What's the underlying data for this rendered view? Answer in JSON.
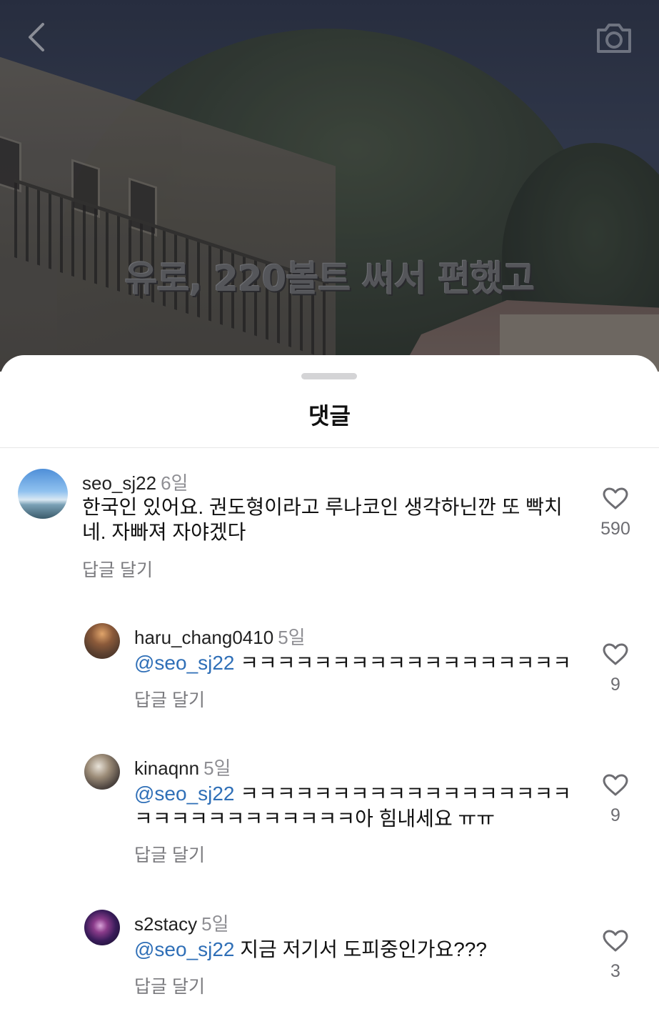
{
  "video": {
    "caption": "유로, 220볼트 써서 편했고"
  },
  "sheet": {
    "title": "댓글"
  },
  "comments": [
    {
      "username": "seo_sj22",
      "time": "6일",
      "text": "한국인 있어요. 권도형이라고 루나코인 생각하닌깐 또 빡치네. 자빠져 자야겠다",
      "reply_label": "답글 달기",
      "likes": "590"
    },
    {
      "username": "haru_chang0410",
      "time": "5일",
      "mention": "@seo_sj22",
      "text": "ㅋㅋㅋㅋㅋㅋㅋㅋㅋㅋㅋㅋㅋㅋㅋㅋㅋㅋ",
      "reply_label": "답글 달기",
      "likes": "9"
    },
    {
      "username": "kinaqnn",
      "time": "5일",
      "mention": "@seo_sj22",
      "text": "ㅋㅋㅋㅋㅋㅋㅋㅋㅋㅋㅋㅋㅋㅋㅋㅋㅋㅋㅋㅋㅋㅋㅋㅋㅋㅋㅋㅋㅋㅋ아 힘내세요 ㅠㅠ",
      "reply_label": "답글 달기",
      "likes": "9"
    },
    {
      "username": "s2stacy",
      "time": "5일",
      "mention": "@seo_sj22",
      "text": "지금 저기서 도피중인가요???",
      "reply_label": "답글 달기",
      "likes": "3"
    }
  ],
  "icons": {
    "back": "chevron-left-icon",
    "camera": "camera-icon",
    "like": "heart-outline-icon"
  },
  "colors": {
    "mention": "#2f6fb7",
    "secondary_text": "#8e8e93"
  }
}
